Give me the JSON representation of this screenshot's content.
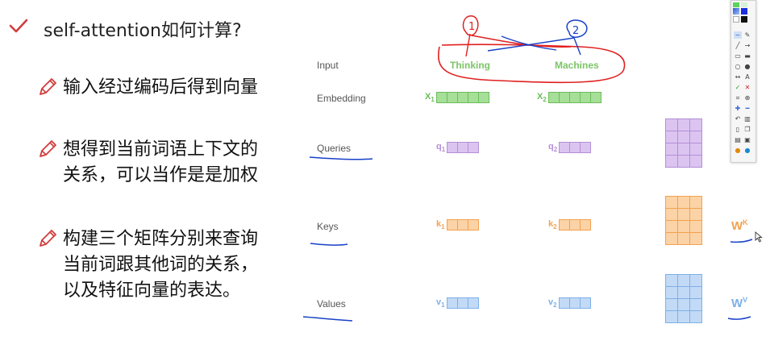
{
  "title": "self-attention如何计算?",
  "bullets": [
    {
      "lines": [
        "输入经过编码后得到向量"
      ]
    },
    {
      "lines": [
        "想得到当前词语上下文的",
        "关系，可以当作是是加权"
      ]
    },
    {
      "lines": [
        "构建三个矩阵分别来查询",
        "当前词跟其他词的关系，",
        "以及特征向量的表达。"
      ]
    }
  ],
  "diagram": {
    "row_labels": {
      "input": "Input",
      "embedding": "Embedding",
      "queries": "Queries",
      "keys": "Keys",
      "values": "Values"
    },
    "words": [
      "Thinking",
      "Machines"
    ],
    "vectors": {
      "x": [
        "X",
        "X"
      ],
      "q": [
        "q",
        "q"
      ],
      "k": [
        "k",
        "k"
      ],
      "v": [
        "v",
        "v"
      ]
    },
    "subscripts": [
      "1",
      "2"
    ],
    "weights": {
      "k_base": "W",
      "k_sup": "K",
      "v_base": "W",
      "v_sup": "V"
    },
    "annotations": {
      "circle_1": "1",
      "circle_2": "2"
    },
    "colors": {
      "embedding": "#a6df98",
      "embedding_border": "#6cbc5c",
      "query": "#dcc4f0",
      "query_border": "#b38fd6",
      "key": "#fbd3a6",
      "key_border": "#f2a250",
      "value": "#c2daf6",
      "value_border": "#7fb0e6",
      "word": "#7cc466",
      "ink_red": "#e02020",
      "ink_blue": "#1840c8"
    }
  },
  "toolbar": {
    "icons": [
      "pen-icon",
      "eraser-icon",
      "line-icon",
      "arrow-icon",
      "rect-icon",
      "filled-rect-icon",
      "ellipse-icon",
      "filled-ellipse-icon",
      "double-arrow-icon",
      "text-icon",
      "check-icon",
      "cross-icon",
      "crop-icon",
      "zoom-icon",
      "plus-icon",
      "minus-icon",
      "undo-icon",
      "delete-icon",
      "new-page-icon",
      "copy-icon",
      "print-icon",
      "save-icon",
      "settings-icon",
      "info-icon"
    ]
  }
}
